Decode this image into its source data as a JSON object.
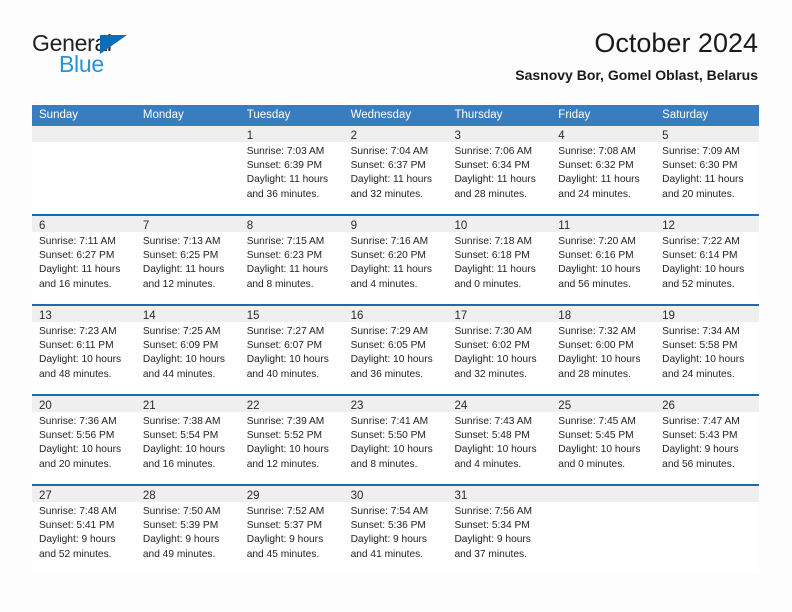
{
  "branding": {
    "logo_text_primary": "General",
    "logo_text_secondary": "Blue",
    "logo_triangle_icon": "triangle-icon",
    "primary_color": "#0b6cb7",
    "secondary_color": "#2a93d5"
  },
  "header": {
    "title": "October 2024",
    "subtitle": "Sasnovy Bor, Gomel Oblast, Belarus"
  },
  "theme": {
    "header_row_bg": "#3a7dbf",
    "week_divider": "#1d6aae",
    "day_band_bg": "#efefef"
  },
  "calendar": {
    "weekdays": [
      "Sunday",
      "Monday",
      "Tuesday",
      "Wednesday",
      "Thursday",
      "Friday",
      "Saturday"
    ],
    "weeks": [
      [
        {
          "day": "",
          "lines": []
        },
        {
          "day": "",
          "lines": []
        },
        {
          "day": "1",
          "lines": [
            "Sunrise: 7:03 AM",
            "Sunset: 6:39 PM",
            "Daylight: 11 hours",
            "and 36 minutes."
          ]
        },
        {
          "day": "2",
          "lines": [
            "Sunrise: 7:04 AM",
            "Sunset: 6:37 PM",
            "Daylight: 11 hours",
            "and 32 minutes."
          ]
        },
        {
          "day": "3",
          "lines": [
            "Sunrise: 7:06 AM",
            "Sunset: 6:34 PM",
            "Daylight: 11 hours",
            "and 28 minutes."
          ]
        },
        {
          "day": "4",
          "lines": [
            "Sunrise: 7:08 AM",
            "Sunset: 6:32 PM",
            "Daylight: 11 hours",
            "and 24 minutes."
          ]
        },
        {
          "day": "5",
          "lines": [
            "Sunrise: 7:09 AM",
            "Sunset: 6:30 PM",
            "Daylight: 11 hours",
            "and 20 minutes."
          ]
        }
      ],
      [
        {
          "day": "6",
          "lines": [
            "Sunrise: 7:11 AM",
            "Sunset: 6:27 PM",
            "Daylight: 11 hours",
            "and 16 minutes."
          ]
        },
        {
          "day": "7",
          "lines": [
            "Sunrise: 7:13 AM",
            "Sunset: 6:25 PM",
            "Daylight: 11 hours",
            "and 12 minutes."
          ]
        },
        {
          "day": "8",
          "lines": [
            "Sunrise: 7:15 AM",
            "Sunset: 6:23 PM",
            "Daylight: 11 hours",
            "and 8 minutes."
          ]
        },
        {
          "day": "9",
          "lines": [
            "Sunrise: 7:16 AM",
            "Sunset: 6:20 PM",
            "Daylight: 11 hours",
            "and 4 minutes."
          ]
        },
        {
          "day": "10",
          "lines": [
            "Sunrise: 7:18 AM",
            "Sunset: 6:18 PM",
            "Daylight: 11 hours",
            "and 0 minutes."
          ]
        },
        {
          "day": "11",
          "lines": [
            "Sunrise: 7:20 AM",
            "Sunset: 6:16 PM",
            "Daylight: 10 hours",
            "and 56 minutes."
          ]
        },
        {
          "day": "12",
          "lines": [
            "Sunrise: 7:22 AM",
            "Sunset: 6:14 PM",
            "Daylight: 10 hours",
            "and 52 minutes."
          ]
        }
      ],
      [
        {
          "day": "13",
          "lines": [
            "Sunrise: 7:23 AM",
            "Sunset: 6:11 PM",
            "Daylight: 10 hours",
            "and 48 minutes."
          ]
        },
        {
          "day": "14",
          "lines": [
            "Sunrise: 7:25 AM",
            "Sunset: 6:09 PM",
            "Daylight: 10 hours",
            "and 44 minutes."
          ]
        },
        {
          "day": "15",
          "lines": [
            "Sunrise: 7:27 AM",
            "Sunset: 6:07 PM",
            "Daylight: 10 hours",
            "and 40 minutes."
          ]
        },
        {
          "day": "16",
          "lines": [
            "Sunrise: 7:29 AM",
            "Sunset: 6:05 PM",
            "Daylight: 10 hours",
            "and 36 minutes."
          ]
        },
        {
          "day": "17",
          "lines": [
            "Sunrise: 7:30 AM",
            "Sunset: 6:02 PM",
            "Daylight: 10 hours",
            "and 32 minutes."
          ]
        },
        {
          "day": "18",
          "lines": [
            "Sunrise: 7:32 AM",
            "Sunset: 6:00 PM",
            "Daylight: 10 hours",
            "and 28 minutes."
          ]
        },
        {
          "day": "19",
          "lines": [
            "Sunrise: 7:34 AM",
            "Sunset: 5:58 PM",
            "Daylight: 10 hours",
            "and 24 minutes."
          ]
        }
      ],
      [
        {
          "day": "20",
          "lines": [
            "Sunrise: 7:36 AM",
            "Sunset: 5:56 PM",
            "Daylight: 10 hours",
            "and 20 minutes."
          ]
        },
        {
          "day": "21",
          "lines": [
            "Sunrise: 7:38 AM",
            "Sunset: 5:54 PM",
            "Daylight: 10 hours",
            "and 16 minutes."
          ]
        },
        {
          "day": "22",
          "lines": [
            "Sunrise: 7:39 AM",
            "Sunset: 5:52 PM",
            "Daylight: 10 hours",
            "and 12 minutes."
          ]
        },
        {
          "day": "23",
          "lines": [
            "Sunrise: 7:41 AM",
            "Sunset: 5:50 PM",
            "Daylight: 10 hours",
            "and 8 minutes."
          ]
        },
        {
          "day": "24",
          "lines": [
            "Sunrise: 7:43 AM",
            "Sunset: 5:48 PM",
            "Daylight: 10 hours",
            "and 4 minutes."
          ]
        },
        {
          "day": "25",
          "lines": [
            "Sunrise: 7:45 AM",
            "Sunset: 5:45 PM",
            "Daylight: 10 hours",
            "and 0 minutes."
          ]
        },
        {
          "day": "26",
          "lines": [
            "Sunrise: 7:47 AM",
            "Sunset: 5:43 PM",
            "Daylight: 9 hours",
            "and 56 minutes."
          ]
        }
      ],
      [
        {
          "day": "27",
          "lines": [
            "Sunrise: 7:48 AM",
            "Sunset: 5:41 PM",
            "Daylight: 9 hours",
            "and 52 minutes."
          ]
        },
        {
          "day": "28",
          "lines": [
            "Sunrise: 7:50 AM",
            "Sunset: 5:39 PM",
            "Daylight: 9 hours",
            "and 49 minutes."
          ]
        },
        {
          "day": "29",
          "lines": [
            "Sunrise: 7:52 AM",
            "Sunset: 5:37 PM",
            "Daylight: 9 hours",
            "and 45 minutes."
          ]
        },
        {
          "day": "30",
          "lines": [
            "Sunrise: 7:54 AM",
            "Sunset: 5:36 PM",
            "Daylight: 9 hours",
            "and 41 minutes."
          ]
        },
        {
          "day": "31",
          "lines": [
            "Sunrise: 7:56 AM",
            "Sunset: 5:34 PM",
            "Daylight: 9 hours",
            "and 37 minutes."
          ]
        },
        {
          "day": "",
          "lines": []
        },
        {
          "day": "",
          "lines": []
        }
      ]
    ]
  }
}
